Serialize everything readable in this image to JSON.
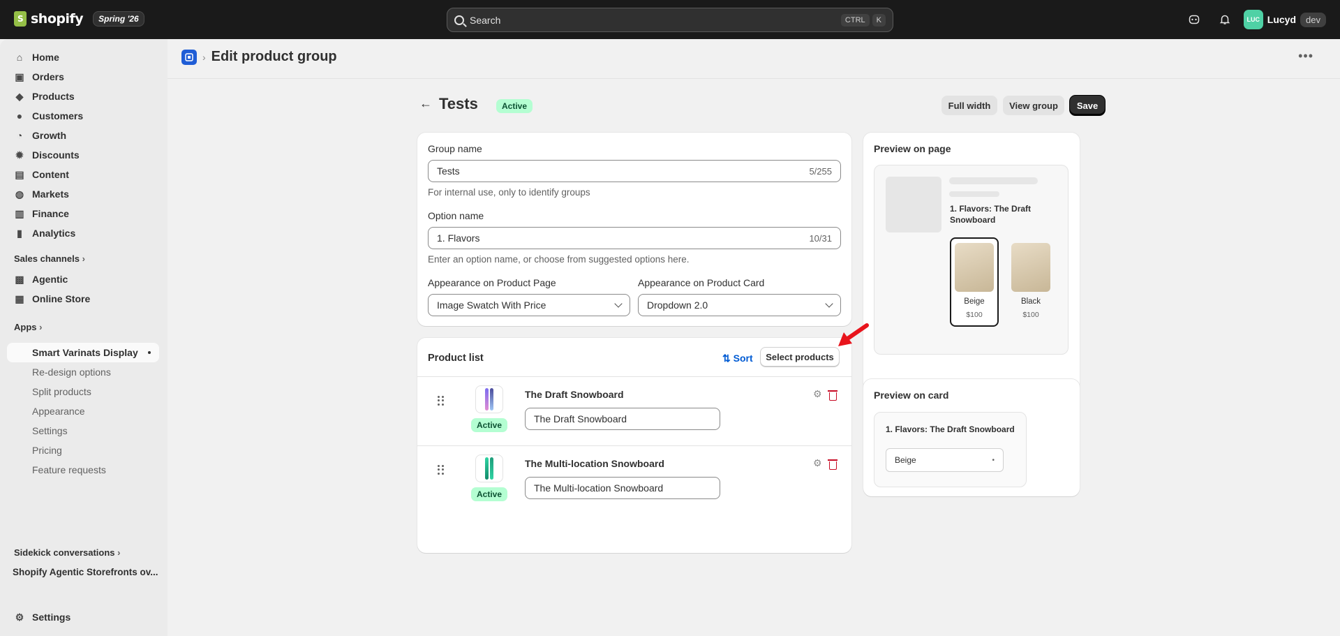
{
  "topbar": {
    "logo_text": "shopify",
    "release_badge": "Spring '26",
    "search_placeholder": "Search",
    "shortcut_keys": [
      "CTRL",
      "K"
    ],
    "avatar_initials": "LUC",
    "store_name": "Lucyd",
    "store_badge": "dev"
  },
  "sidebar": {
    "nav": [
      {
        "label": "Home",
        "icon": "home-icon",
        "glyph": "⌂"
      },
      {
        "label": "Orders",
        "icon": "inbox-icon",
        "glyph": "▣"
      },
      {
        "label": "Products",
        "icon": "tag-icon",
        "glyph": "◆"
      },
      {
        "label": "Customers",
        "icon": "person-icon",
        "glyph": "●"
      },
      {
        "label": "Growth",
        "icon": "growth-icon",
        "glyph": "◔"
      },
      {
        "label": "Discounts",
        "icon": "discount-icon",
        "glyph": "✹"
      },
      {
        "label": "Content",
        "icon": "content-icon",
        "glyph": "▤"
      },
      {
        "label": "Markets",
        "icon": "globe-icon",
        "glyph": "◍"
      },
      {
        "label": "Finance",
        "icon": "bank-icon",
        "glyph": "▥"
      },
      {
        "label": "Analytics",
        "icon": "chart-icon",
        "glyph": "▮"
      }
    ],
    "sales_channels_label": "Sales channels",
    "channels": [
      {
        "label": "Agentic",
        "icon": "agentic-icon",
        "glyph": "▩"
      },
      {
        "label": "Online Store",
        "icon": "storefront-icon",
        "glyph": "▦"
      }
    ],
    "apps_label": "Apps",
    "app_items": [
      {
        "label": "Smart Varinats Display"
      },
      {
        "label": "Re-design options"
      },
      {
        "label": "Split products"
      },
      {
        "label": "Appearance"
      },
      {
        "label": "Settings"
      },
      {
        "label": "Pricing"
      },
      {
        "label": "Feature requests"
      }
    ],
    "sidekick_label": "Sidekick conversations",
    "sidekick_item": "Shopify Agentic Storefronts ov...",
    "settings_label": "Settings"
  },
  "header": {
    "title": "Edit product group"
  },
  "group": {
    "title": "Tests",
    "status": "Active",
    "buttons": {
      "full_width": "Full width",
      "view_group": "View group",
      "save": "Save"
    }
  },
  "form": {
    "group_name_label": "Group name",
    "group_name_value": "Tests",
    "group_name_counter": "5/255",
    "group_name_help": "For internal use, only to identify groups",
    "option_name_label": "Option name",
    "option_name_value": "1. Flavors",
    "option_name_counter": "10/31",
    "option_name_help": "Enter an option name, or choose from suggested options here.",
    "appearance_page_label": "Appearance on Product Page",
    "appearance_page_value": "Image Swatch With Price",
    "appearance_card_label": "Appearance on Product Card",
    "appearance_card_value": "Dropdown 2.0"
  },
  "product_list": {
    "title": "Product list",
    "sort_label": "Sort",
    "select_label": "Select products",
    "rows": [
      {
        "name": "The Draft Snowboard",
        "status": "Active",
        "option_value": "The Draft Snowboard"
      },
      {
        "name": "The Multi-location Snowboard",
        "status": "Active",
        "option_value": "The Multi-location Snowboard"
      }
    ]
  },
  "preview_page": {
    "title": "Preview on page",
    "product_title": "1. Flavors: The Draft Snowboard",
    "swatches": [
      {
        "label": "Beige",
        "price": "$100"
      },
      {
        "label": "Black",
        "price": "$100"
      }
    ]
  },
  "preview_card": {
    "title": "Preview on card",
    "product_title": "1. Flavors: The Draft Snowboard",
    "select_value": "Beige"
  },
  "colors": {
    "accent_link": "#005bd3",
    "active_badge_bg": "#b4fed2",
    "danger": "#c70a24",
    "annotation": "#e8141c"
  }
}
